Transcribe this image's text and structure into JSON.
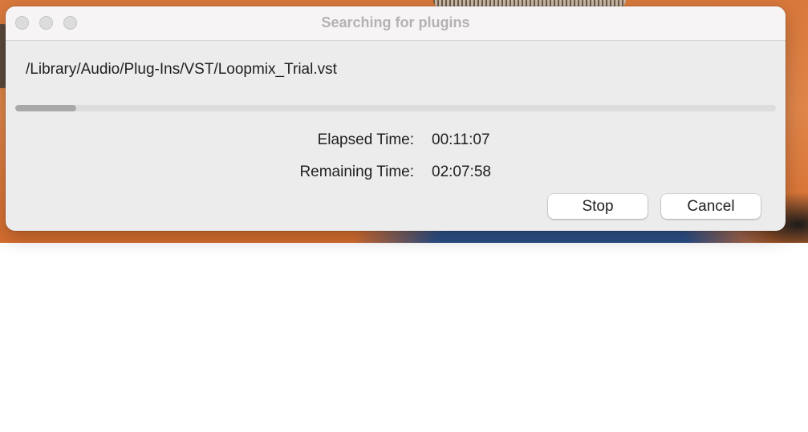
{
  "window": {
    "title": "Searching for plugins"
  },
  "scan": {
    "current_path": "/Library/Audio/Plug-Ins/VST/Loopmix_Trial.vst",
    "progress_fraction": 0.08
  },
  "timing": {
    "elapsed_label": "Elapsed Time:",
    "elapsed_value": "00:11:07",
    "remaining_label": "Remaining Time:",
    "remaining_value": "02:07:58"
  },
  "buttons": {
    "stop_label": "Stop",
    "cancel_label": "Cancel"
  },
  "colors": {
    "window_bg": "#ececec",
    "titlebar_bg": "#f6f4f4",
    "title_text": "#b4b2b2",
    "progress_track": "#dddddd",
    "progress_fill": "#a9a9a9"
  }
}
